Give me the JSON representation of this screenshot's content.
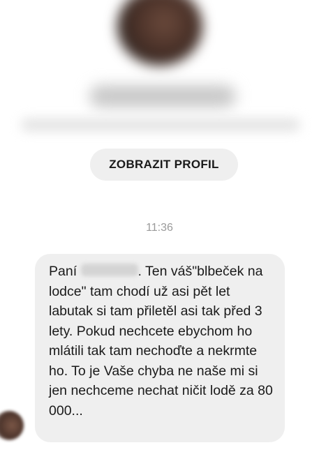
{
  "profile": {
    "view_profile_label": "ZOBRAZIT PROFIL"
  },
  "conversation": {
    "timestamp": "11:36",
    "message": {
      "salutation": "Paní",
      "body": ". Ten váš\"blbeček na lodce\" tam chodí už asi pět let labutak si tam přiletěl asi tak před 3 lety. Pokud nechcete ebychom ho mlátili tak tam nechoďte a nekrmte ho. To je Vaše chyba ne naše mi si jen nechceme nechat ničit lodě za 80 000..."
    }
  }
}
